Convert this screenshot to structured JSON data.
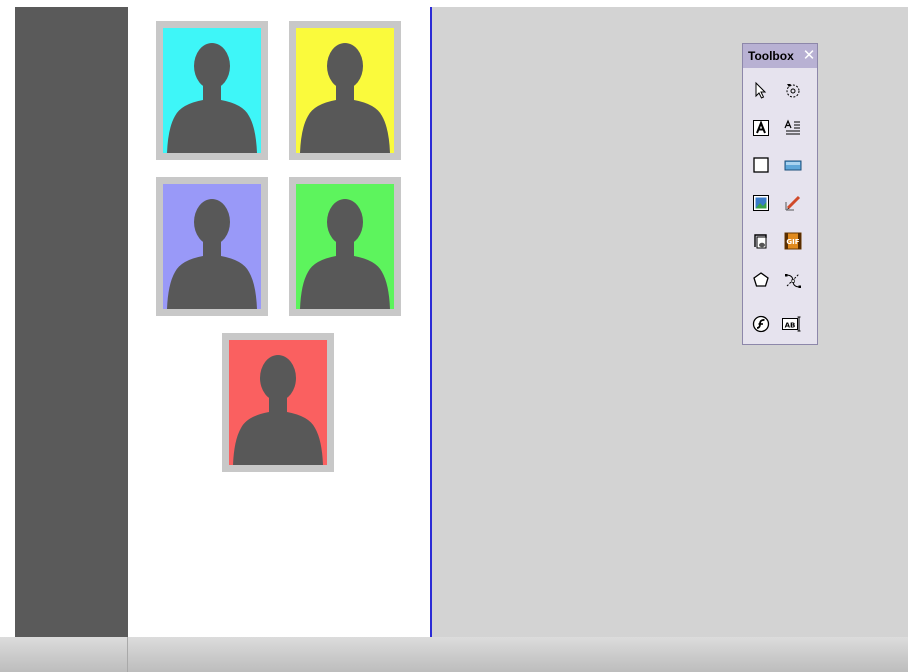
{
  "toolbox": {
    "title": "Toolbox",
    "close_glyph": "✕",
    "tools": [
      {
        "name": "pointer-tool-icon"
      },
      {
        "name": "rotate-tool-icon"
      },
      {
        "name": "text-frame-tool-icon"
      },
      {
        "name": "text-flow-tool-icon"
      },
      {
        "name": "rectangle-tool-icon"
      },
      {
        "name": "button-tool-icon"
      },
      {
        "name": "image-tool-icon"
      },
      {
        "name": "pen-tool-icon"
      },
      {
        "name": "sound-tool-icon"
      },
      {
        "name": "gif-tool-icon"
      },
      {
        "name": "polygon-tool-icon"
      },
      {
        "name": "path-edit-tool-icon"
      },
      {
        "name": "flash-tool-icon"
      },
      {
        "name": "form-field-tool-icon",
        "text": "AB"
      }
    ]
  },
  "photos": [
    {
      "name": "photo-cyan",
      "color": "#3ef6f8"
    },
    {
      "name": "photo-yellow",
      "color": "#fafa3c"
    },
    {
      "name": "photo-blue",
      "color": "#9999f8"
    },
    {
      "name": "photo-green",
      "color": "#5df45d"
    },
    {
      "name": "photo-red",
      "color": "#fa6060"
    }
  ],
  "colors": {
    "gutter": "#5a5a5a",
    "canvas": "#d3d3d3",
    "page_border": "#2b2bd6",
    "silhouette": "#585858",
    "toolbox_title_bg": "#b8b1d3"
  }
}
